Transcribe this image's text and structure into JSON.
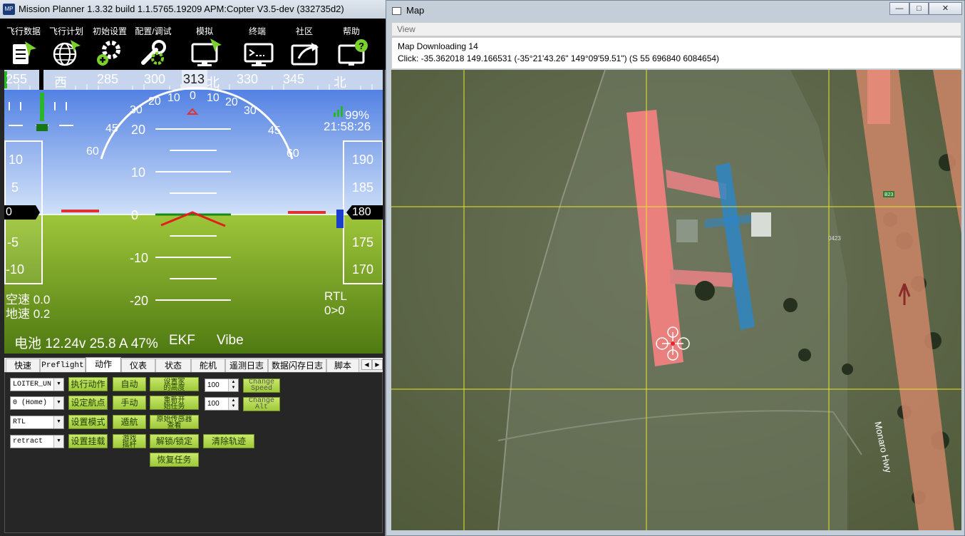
{
  "main_window": {
    "title": "Mission Planner 1.3.32 build 1.1.5765.19209 APM:Copter V3.5-dev (332735d2)",
    "logo": "MP",
    "menu": [
      {
        "label": "飞行数据",
        "icon": "flight-data-icon"
      },
      {
        "label": "飞行计划",
        "icon": "flight-plan-icon"
      },
      {
        "label": "初始设置",
        "icon": "initial-setup-icon"
      },
      {
        "label": "配置/调试",
        "icon": "config-tuning-icon"
      },
      {
        "label": "模拟",
        "icon": "simulation-icon"
      },
      {
        "label": "终端",
        "icon": "terminal-icon"
      },
      {
        "label": "社区",
        "icon": "community-icon"
      },
      {
        "label": "帮助",
        "icon": "help-icon"
      }
    ]
  },
  "hud": {
    "heading_ticks": [
      "255",
      "西",
      "285",
      "300",
      "313",
      "北",
      "330",
      "345",
      "北"
    ],
    "heading_value": "313",
    "pitch_ticks": [
      "20",
      "10",
      "0",
      "-10",
      "-20"
    ],
    "roll_ticks": [
      "60",
      "45",
      "30",
      "20",
      "10",
      "0",
      "10",
      "20",
      "30",
      "45",
      "60"
    ],
    "speed_ticks": [
      "10",
      "5",
      "0",
      "-5",
      "-10"
    ],
    "speed_value": "0",
    "alt_ticks": [
      "190",
      "185",
      "180",
      "175",
      "170"
    ],
    "alt_value": "180",
    "link_quality": "99%",
    "time": "21:58:26",
    "airspeed": "空速 0.0",
    "groundspeed": "地速 0.2",
    "mode": "RTL",
    "waypoint": "0>0",
    "battery": "电池 12.24v 25.8 A 47%",
    "ekf": "EKF",
    "vibe": "Vibe",
    "colors": {
      "sky": "#5a89e6",
      "ground": "#8cba2e",
      "horizon_marker": "#e03030"
    }
  },
  "tabs": {
    "items": [
      "快速",
      "Preflight",
      "动作",
      "仪表",
      "状态",
      "舵机",
      "遥测日志",
      "数据闪存日志",
      "脚本"
    ],
    "active": "动作",
    "left_arrow": "◀",
    "right_arrow": "▶"
  },
  "actions": {
    "select_action": "LOITER_UN",
    "select_wp": "0 (Home)",
    "select_mode": "RTL",
    "select_mount": "retract",
    "btn_do_action": "执行动作",
    "btn_set_wp": "设定航点",
    "btn_set_mode": "设置模式",
    "btn_set_mount": "设置挂载",
    "btn_auto": "自动",
    "btn_manual": "手动",
    "btn_loiter": "遁航",
    "btn_joystick": "游戏摇杆",
    "btn_set_home_alt": "设置家的高度",
    "btn_restart_mission": "重新开始任务",
    "btn_raw_sensor": "原始传感器查看",
    "btn_arm_disarm": "解锁/锁定",
    "btn_clear_track": "清除轨迹",
    "btn_resume_mission": "恢复任务",
    "speed_value": "100",
    "alt_value": "100",
    "btn_change_speed": "Change Speed",
    "btn_change_alt": "Change Alt"
  },
  "map_window": {
    "title": "Map",
    "menu_view": "View",
    "status": "Map Downloading 14",
    "click_info": "Click: -35.362018 149.166531 (-35°21'43.26\" 149°09'59.51\") (S 55 696840 6084654)",
    "road_name": "Monaro Hwy",
    "road_badge": "B23",
    "road_label2": "0423",
    "minimize": "—",
    "maximize": "□",
    "close": "✕"
  }
}
